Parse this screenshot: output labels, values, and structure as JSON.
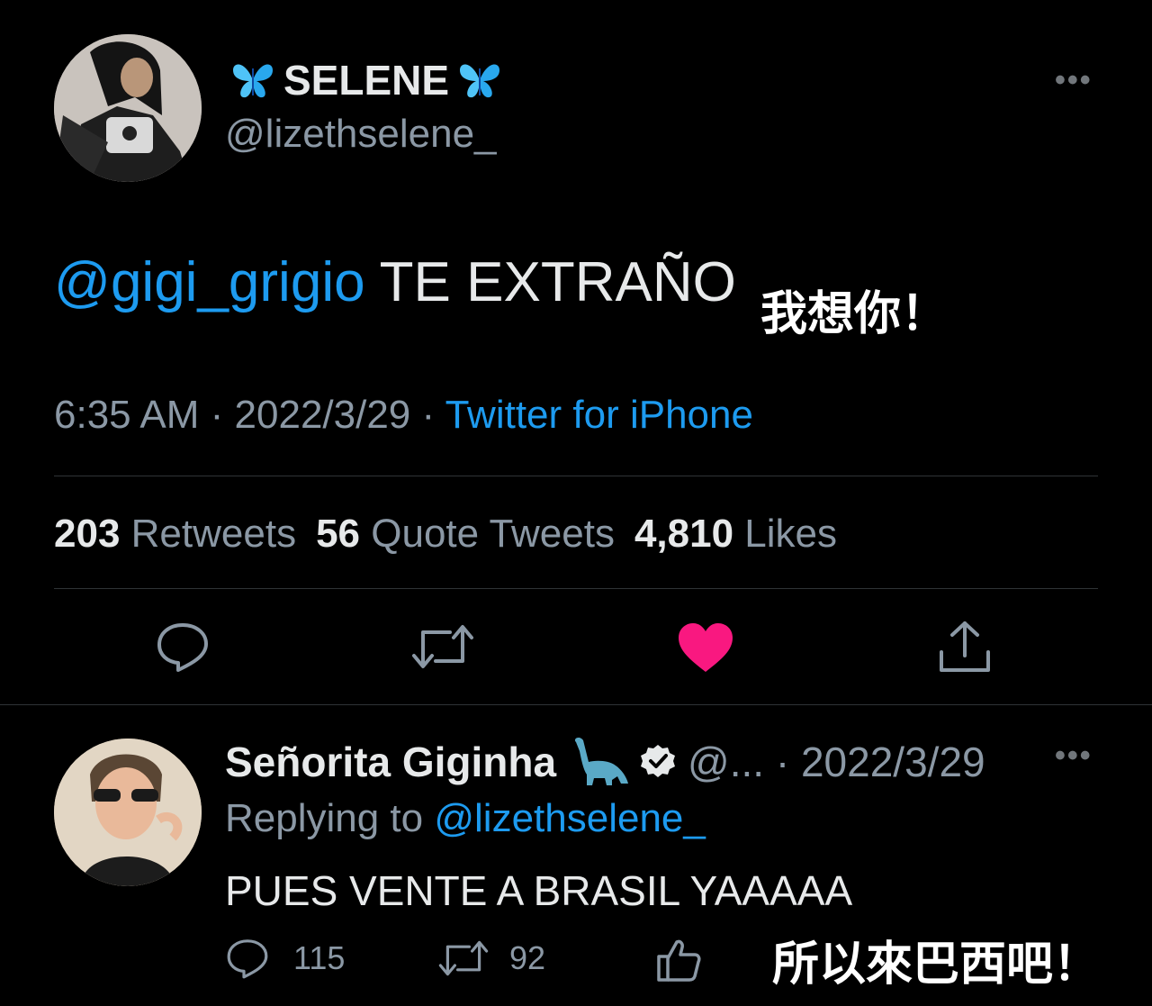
{
  "main_tweet": {
    "display_name": "SELENE",
    "name_emoji": "butterfly-emoji",
    "handle": "@lizethselene_",
    "text_mention": "@gigi_grigio",
    "text_body": " TE EXTRAÑO",
    "time": "6:35 AM · 2022/3/29 · ",
    "source": "Twitter for iPhone",
    "more_label": "•••",
    "stats": {
      "retweets_count": "203",
      "retweets_label": "Retweets",
      "quotes_count": "56",
      "quotes_label": "Quote Tweets",
      "likes_count": "4,810",
      "likes_label": "Likes"
    },
    "actions": {
      "reply_icon": "reply-icon",
      "retweet_icon": "retweet-icon",
      "like_icon": "heart-icon",
      "like_color": "#f91880",
      "share_icon": "share-icon"
    }
  },
  "overlay": {
    "caption_1": "我想你！",
    "caption_2": "所以來巴西吧！"
  },
  "reply_tweet": {
    "display_name": "Señorita Giginha",
    "name_emoji": "sauropod-emoji",
    "verified_icon": "verified-icon",
    "handle_and_date": "@... · 2022/3/29",
    "replying_prefix": "Replying to ",
    "replying_mention": "@lizethselene_",
    "text": "PUES VENTE A BRASIL YAAAAA",
    "more_label": "•••",
    "reply_count": "115",
    "retweet_count": "92"
  },
  "colors": {
    "background": "#000000",
    "accent": "#1d9bf0",
    "muted": "#8b98a5",
    "divider": "#2f3336",
    "like": "#f91880"
  }
}
